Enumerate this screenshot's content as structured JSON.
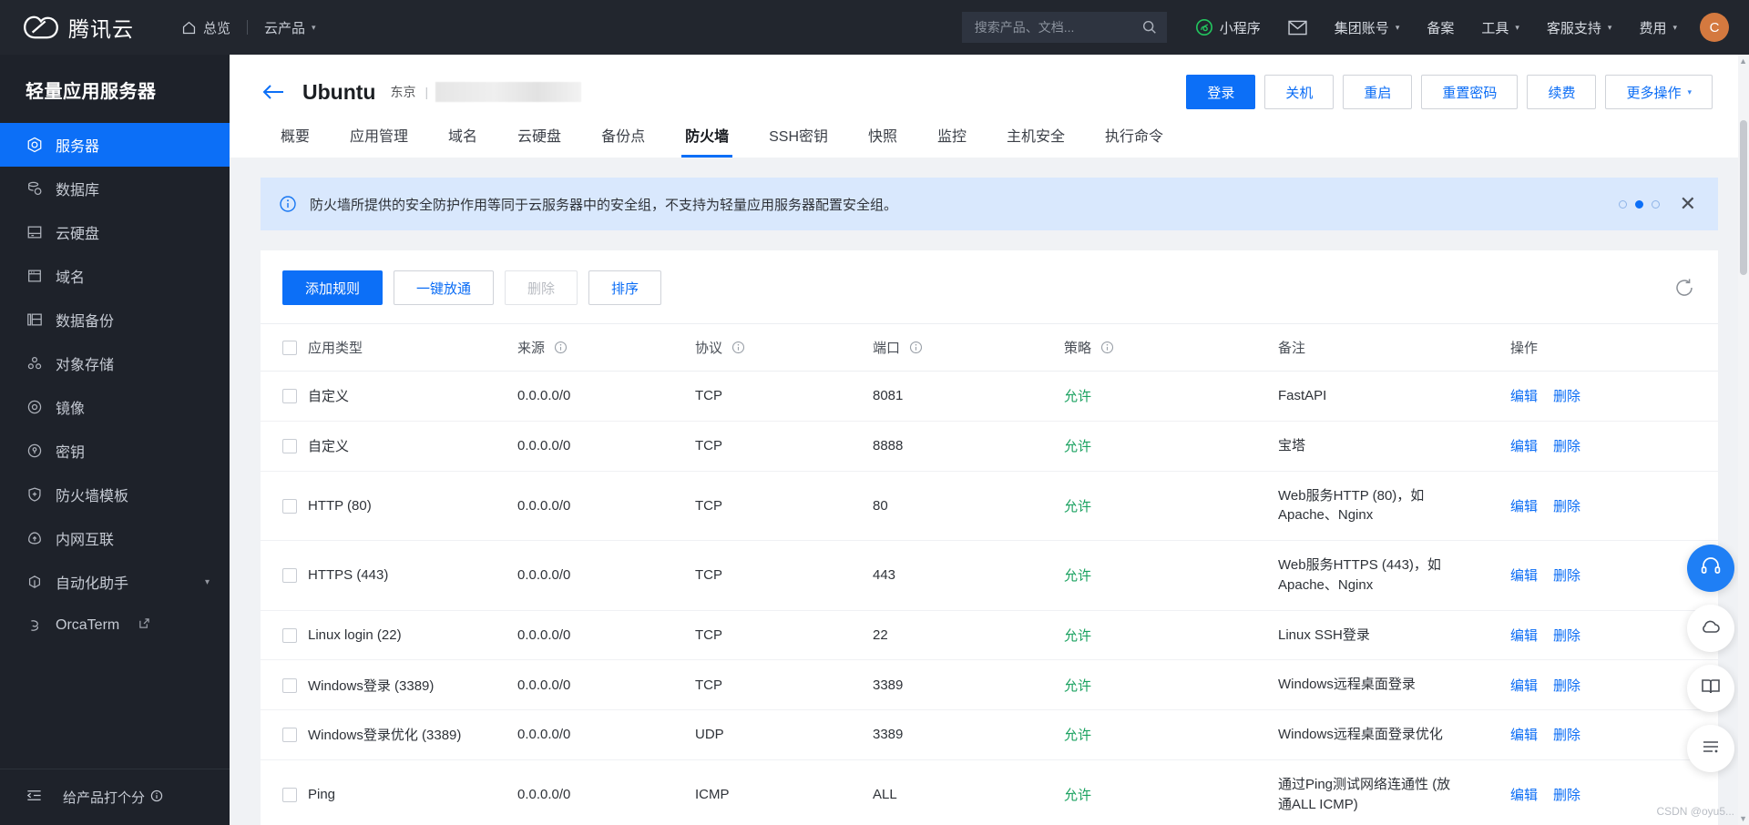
{
  "topbar": {
    "brand": "腾讯云",
    "nav": [
      {
        "label": "总览",
        "icon": "home-icon"
      },
      {
        "label": "云产品",
        "icon": "chevron-down-icon"
      }
    ],
    "search": {
      "placeholder": "搜索产品、文档...",
      "value": "",
      "icon": "search-icon"
    },
    "right_items": [
      {
        "label": "小程序",
        "icon": "miniprogram-icon"
      },
      {
        "label": "",
        "icon": "mail-icon"
      },
      {
        "label": "集团账号",
        "icon": "chevron-down-icon"
      },
      {
        "label": "备案",
        "icon": ""
      },
      {
        "label": "工具",
        "icon": "chevron-down-icon"
      },
      {
        "label": "客服支持",
        "icon": "chevron-down-icon"
      },
      {
        "label": "费用",
        "icon": "chevron-down-icon"
      }
    ],
    "avatar_letter": "C"
  },
  "sidebar": {
    "title": "轻量应用服务器",
    "items": [
      {
        "label": "服务器",
        "icon": "server-icon",
        "active": true
      },
      {
        "label": "数据库",
        "icon": "database-icon",
        "active": false
      },
      {
        "label": "云硬盘",
        "icon": "disk-icon",
        "active": false
      },
      {
        "label": "域名",
        "icon": "domain-icon",
        "active": false
      },
      {
        "label": "数据备份",
        "icon": "backup-icon",
        "active": false
      },
      {
        "label": "对象存储",
        "icon": "object-storage-icon",
        "active": false
      },
      {
        "label": "镜像",
        "icon": "image-icon",
        "active": false
      },
      {
        "label": "密钥",
        "icon": "key-icon",
        "active": false
      },
      {
        "label": "防火墙模板",
        "icon": "shield-icon",
        "active": false
      },
      {
        "label": "内网互联",
        "icon": "network-icon",
        "active": false
      },
      {
        "label": "自动化助手",
        "icon": "automation-icon",
        "active": false,
        "expandable": true
      },
      {
        "label": "OrcaTerm",
        "icon": "terminal-icon",
        "active": false,
        "external": true
      }
    ],
    "footer": {
      "rate_label": "给产品打个分",
      "collapse_icon": "collapse-icon",
      "rate_icon": "info-circle-icon"
    }
  },
  "header": {
    "back_icon": "back-arrow-icon",
    "instance_name": "Ubuntu",
    "region": "东京",
    "divider": "|",
    "actions": [
      {
        "label": "登录",
        "primary": true
      },
      {
        "label": "关机",
        "primary": false
      },
      {
        "label": "重启",
        "primary": false
      },
      {
        "label": "重置密码",
        "primary": false
      },
      {
        "label": "续费",
        "primary": false
      },
      {
        "label": "更多操作",
        "primary": false,
        "caret": true
      }
    ]
  },
  "tabs": [
    {
      "label": "概要",
      "active": false
    },
    {
      "label": "应用管理",
      "active": false
    },
    {
      "label": "域名",
      "active": false
    },
    {
      "label": "云硬盘",
      "active": false
    },
    {
      "label": "备份点",
      "active": false
    },
    {
      "label": "防火墙",
      "active": true
    },
    {
      "label": "SSH密钥",
      "active": false
    },
    {
      "label": "快照",
      "active": false
    },
    {
      "label": "监控",
      "active": false
    },
    {
      "label": "主机安全",
      "active": false
    },
    {
      "label": "执行命令",
      "active": false
    }
  ],
  "banner": {
    "icon": "info-circle-icon",
    "text": "防火墙所提供的安全防护作用等同于云服务器中的安全组，不支持为轻量应用服务器配置安全组。",
    "dots": [
      false,
      true,
      false
    ],
    "close_icon": "close-icon"
  },
  "toolbar": {
    "buttons": [
      {
        "label": "添加规则",
        "primary": true,
        "disabled": false
      },
      {
        "label": "一键放通",
        "primary": false,
        "disabled": false
      },
      {
        "label": "删除",
        "primary": false,
        "disabled": true
      },
      {
        "label": "排序",
        "primary": false,
        "disabled": false
      }
    ],
    "refresh_icon": "refresh-icon"
  },
  "table": {
    "columns": [
      {
        "label": "应用类型",
        "info": false
      },
      {
        "label": "来源",
        "info": true
      },
      {
        "label": "协议",
        "info": true
      },
      {
        "label": "端口",
        "info": true
      },
      {
        "label": "策略",
        "info": true
      },
      {
        "label": "备注",
        "info": false
      },
      {
        "label": "操作",
        "info": false
      }
    ],
    "row_actions": [
      "编辑",
      "删除"
    ],
    "rows": [
      {
        "app": "自定义",
        "source": "0.0.0.0/0",
        "protocol": "TCP",
        "port": "8081",
        "policy": "允许",
        "note": "FastAPI"
      },
      {
        "app": "自定义",
        "source": "0.0.0.0/0",
        "protocol": "TCP",
        "port": "8888",
        "policy": "允许",
        "note": "宝塔"
      },
      {
        "app": "HTTP (80)",
        "source": "0.0.0.0/0",
        "protocol": "TCP",
        "port": "80",
        "policy": "允许",
        "note": "Web服务HTTP (80)，如\nApache、Nginx"
      },
      {
        "app": "HTTPS (443)",
        "source": "0.0.0.0/0",
        "protocol": "TCP",
        "port": "443",
        "policy": "允许",
        "note": "Web服务HTTPS (443)，如\nApache、Nginx"
      },
      {
        "app": "Linux login (22)",
        "source": "0.0.0.0/0",
        "protocol": "TCP",
        "port": "22",
        "policy": "允许",
        "note": "Linux SSH登录"
      },
      {
        "app": "Windows登录 (3389)",
        "source": "0.0.0.0/0",
        "protocol": "TCP",
        "port": "3389",
        "policy": "允许",
        "note": "Windows远程桌面登录"
      },
      {
        "app": "Windows登录优化 (3389)",
        "source": "0.0.0.0/0",
        "protocol": "UDP",
        "port": "3389",
        "policy": "允许",
        "note": "Windows远程桌面登录优化"
      },
      {
        "app": "Ping",
        "source": "0.0.0.0/0",
        "protocol": "ICMP",
        "port": "ALL",
        "policy": "允许",
        "note": "通过Ping测试网络连通性 (放\n通ALL ICMP)"
      }
    ]
  },
  "rail": [
    {
      "icon": "headset-icon",
      "highlight": true
    },
    {
      "icon": "cloud-icon",
      "highlight": false
    },
    {
      "icon": "book-icon",
      "highlight": false
    },
    {
      "icon": "list-icon",
      "highlight": false
    }
  ],
  "watermark": "CSDN @oyu5..."
}
